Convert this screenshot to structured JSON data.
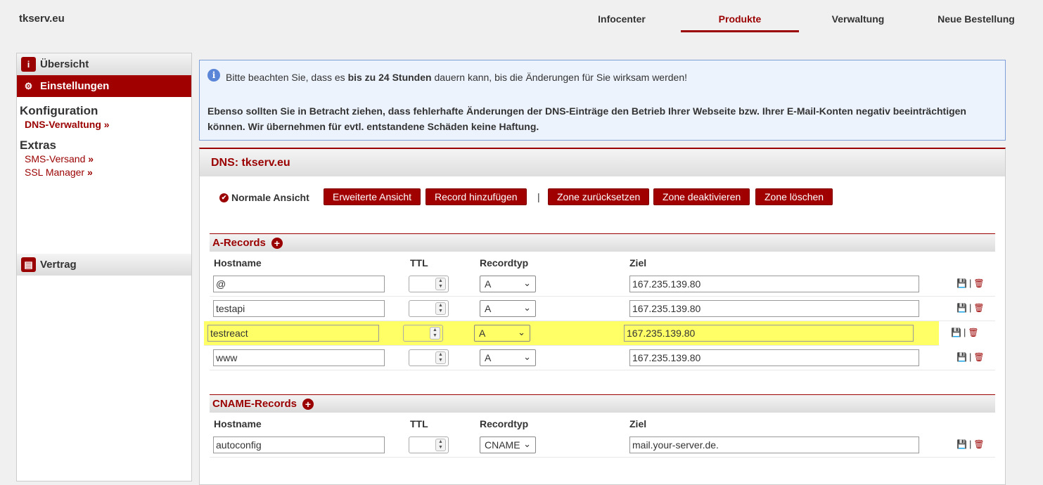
{
  "header": {
    "site_title": "tkserv.eu",
    "nav": [
      "Infocenter",
      "Produkte",
      "Verwaltung",
      "Neue Bestellung"
    ],
    "active_nav": "Produkte"
  },
  "sidebar": {
    "overview": "Übersicht",
    "settings": "Einstellungen",
    "config_heading": "Konfiguration",
    "dns_link": "DNS-Verwaltung",
    "extras_heading": "Extras",
    "sms_link": "SMS-Versand",
    "ssl_link": "SSL Manager",
    "link_chevron": "»",
    "contract": "Vertrag"
  },
  "notice": {
    "line1_pre": "Bitte beachten Sie, dass es ",
    "line1_bold": "bis zu 24 Stunden",
    "line1_post": " dauern kann, bis die Änderungen für Sie wirksam werden!",
    "line2": "Ebenso sollten Sie in Betracht ziehen, dass fehlerhafte Änderungen der DNS-Einträge den Betrieb Ihrer Webseite bzw. Ihrer E-Mail-Konten negativ beeinträchtigen können. Wir übernehmen für evtl. entstandene Schäden keine Haftung."
  },
  "panel": {
    "title": "DNS: tkserv.eu",
    "normal_view": "Normale Ansicht",
    "buttons": {
      "extended_view": "Erweiterte Ansicht",
      "add_record": "Record hinzufügen",
      "separator": "|",
      "reset_zone": "Zone zurücksetzen",
      "deactivate_zone": "Zone deaktivieren",
      "delete_zone": "Zone löschen"
    }
  },
  "columns": {
    "hostname": "Hostname",
    "ttl": "TTL",
    "recordtype": "Recordtyp",
    "target": "Ziel"
  },
  "a_records": {
    "title": "A-Records",
    "rows": [
      {
        "hostname": "@",
        "ttl": "",
        "type": "A",
        "target": "167.235.139.80",
        "highlight": false
      },
      {
        "hostname": "testapi",
        "ttl": "",
        "type": "A",
        "target": "167.235.139.80",
        "highlight": false
      },
      {
        "hostname": "testreact",
        "ttl": "",
        "type": "A",
        "target": "167.235.139.80",
        "highlight": true
      },
      {
        "hostname": "www",
        "ttl": "",
        "type": "A",
        "target": "167.235.139.80",
        "highlight": false
      }
    ]
  },
  "cname_records": {
    "title": "CNAME-Records",
    "rows": [
      {
        "hostname": "autoconfig",
        "ttl": "",
        "type": "CNAME",
        "target": "mail.your-server.de.",
        "highlight": false
      }
    ]
  },
  "colors": {
    "accent": "#9a0000",
    "highlight": "#ffff66",
    "notice_bg": "#edf3fd"
  }
}
